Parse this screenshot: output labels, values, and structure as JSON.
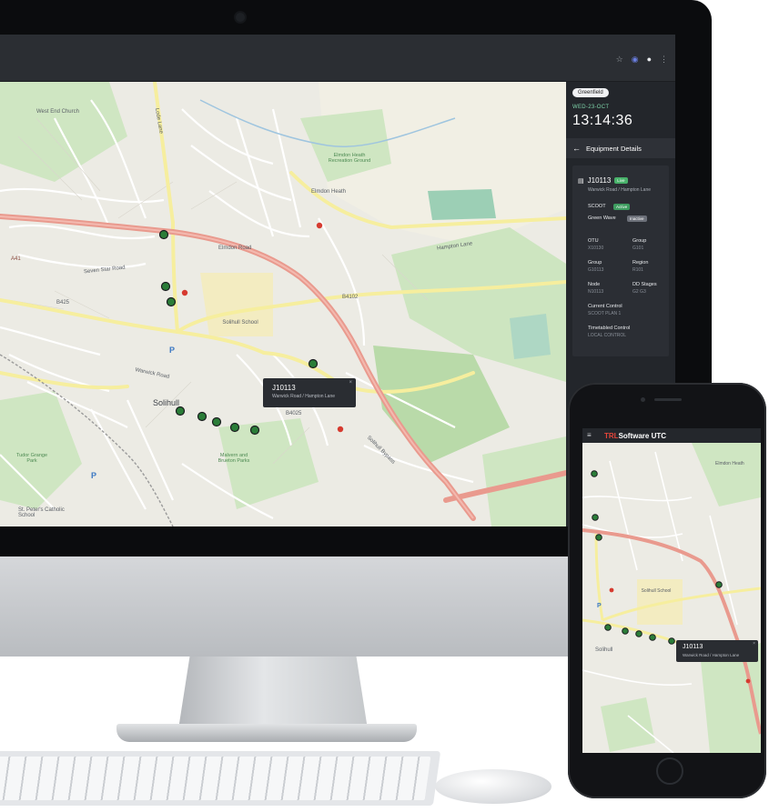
{
  "panel": {
    "area_pill": "Greenfield",
    "date": "WED-23-OCT",
    "time": "13:14:36",
    "header": "Equipment Details",
    "junction": {
      "id": "J10113",
      "status": "Live",
      "location": "Warwick Road / Hampton Lane"
    },
    "scoot_label": "SCOOT",
    "scoot_status": "Active",
    "green_wave_label": "Green Wave",
    "green_wave_status": "Inactive",
    "fields": {
      "otu_label": "OTU",
      "otu_value": "X10130",
      "group1_label": "Group",
      "group1_value": "G101",
      "group2_label": "Group",
      "group2_value": "G10113",
      "region_label": "Region",
      "region_value": "R101",
      "node_label": "Node",
      "node_value": "N10113",
      "stages_label": "DD Stages",
      "stages_value": "G2 G3",
      "current_control_label": "Current Control",
      "current_control_value": "SCOOT PLAN 1",
      "timetabled_control_label": "Timetabled Control",
      "timetabled_control_value": "LOCAL CONTROL"
    }
  },
  "tooltip": {
    "title": "J10113",
    "subtitle": "Warwick Road / Hampton Lane",
    "close": "×"
  },
  "map_labels": {
    "elmdon_heath": "Elmdon Heath",
    "elmdon_rec": "Elmdon Heath Recreation Ground",
    "solihull": "Solihull",
    "solihull_school": "Solihull School",
    "a41": "A41",
    "seven_star_road": "Seven Star Road",
    "hampton_lane": "Hampton Lane",
    "b4102": "B4102",
    "b4025": "B4025",
    "b425": "B425",
    "warwick_road": "Warwick Road",
    "solihull_bypass": "Solihull Bypass",
    "malvern_park": "Malvern and Brueton Parks",
    "tudor_grange": "Tudor Grange Park",
    "st_peters": "St. Peter's Catholic School",
    "west_end": "West End Church",
    "parking": "P",
    "wood_lane": "Lode Lane",
    "ravenshaw": "Grove Road",
    "elmdon_road": "Elmdon Road",
    "church_hill": "Church Hill Road"
  },
  "browser": {
    "icons": [
      "star-icon",
      "extension-icon",
      "account-icon",
      "menu-icon"
    ],
    "glyphs": [
      "☆",
      "◉",
      "●",
      "⋮"
    ]
  },
  "phone": {
    "brand_trl": "TRL",
    "brand_software": "Software",
    "brand_utc": "UTC",
    "menu": "≡",
    "tooltip_title": "J10113",
    "tooltip_subtitle": "Warwick Road / Hampton Lane",
    "tooltip_close": "×",
    "map_labels": {
      "solihull": "Solihull",
      "solihull_school": "Solihull School",
      "elmdon_heath": "Elmdon Heath",
      "parking": "P"
    }
  },
  "colors": {
    "panel_bg": "#23262b",
    "live_green": "#49b26b",
    "date_teal": "#7ed3a9",
    "main_road": "#e89a8f",
    "secondary_road": "#f6f0a8",
    "park_green": "#cfe6c2",
    "marker_green": "#3c8a3f"
  }
}
